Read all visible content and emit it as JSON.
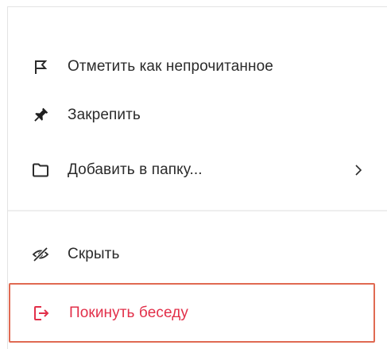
{
  "menu": {
    "items": [
      {
        "label": "Отметить как непрочитанное",
        "icon": "flag-icon"
      },
      {
        "label": "Закрепить",
        "icon": "pin-icon"
      },
      {
        "label": "Добавить в папку...",
        "icon": "folder-icon",
        "has_submenu": true
      },
      {
        "label": "Скрыть",
        "icon": "eye-off-icon"
      },
      {
        "label": "Покинуть беседу",
        "icon": "logout-icon",
        "highlighted": true
      }
    ]
  },
  "colors": {
    "text": "#2b2b2b",
    "danger": "#e2304a",
    "highlight_border": "#e06a52",
    "divider": "#eeeeee"
  }
}
